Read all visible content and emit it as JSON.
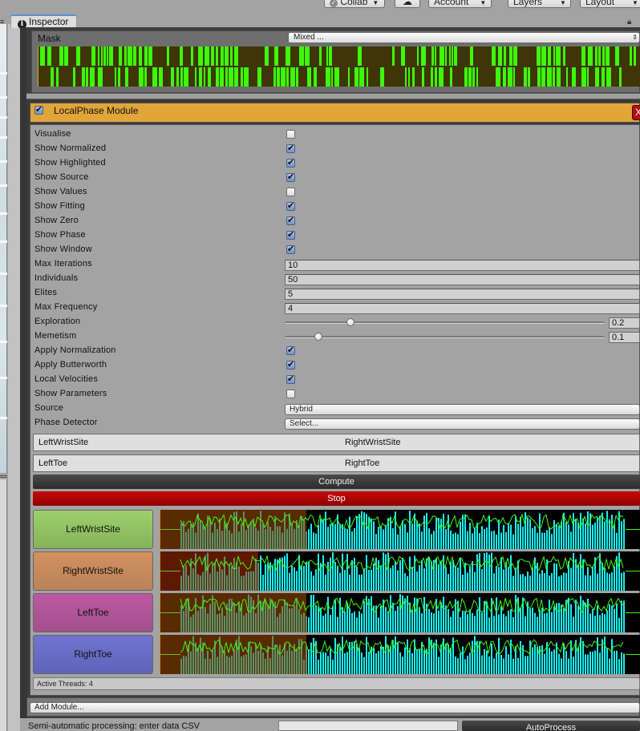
{
  "toolbar": {
    "collab_label": "Collab",
    "cloud_icon": "cloud-icon",
    "account_label": "Account",
    "layers_label": "Layers",
    "layout_label": "Layout"
  },
  "tab": {
    "menu_icon": "≡",
    "title": "Inspector",
    "icon": "info-icon",
    "info_glyph": "i",
    "lock_icon": "lock-icon"
  },
  "mask": {
    "label": "Mask",
    "dropdown_value": "Mixed ...",
    "bar_colors": {
      "on": "#3ef80a",
      "off": "#3f3506"
    }
  },
  "module": {
    "enabled": true,
    "title": "LocalPhase Module",
    "close_label": "X",
    "header_color": "#e0a63a",
    "toggles": [
      {
        "label": "Visualise",
        "checked": false
      },
      {
        "label": "Show Normalized",
        "checked": true
      },
      {
        "label": "Show Highlighted",
        "checked": true
      },
      {
        "label": "Show Source",
        "checked": true
      },
      {
        "label": "Show Values",
        "checked": false
      },
      {
        "label": "Show Fitting",
        "checked": true
      },
      {
        "label": "Show Zero",
        "checked": true
      },
      {
        "label": "Show Phase",
        "checked": true
      },
      {
        "label": "Show Window",
        "checked": true
      }
    ],
    "fields": [
      {
        "label": "Max Iterations",
        "value": "10"
      },
      {
        "label": "Individuals",
        "value": "50"
      },
      {
        "label": "Elites",
        "value": "5"
      },
      {
        "label": "Max Frequency",
        "value": "4"
      }
    ],
    "sliders": [
      {
        "label": "Exploration",
        "value": "0.2",
        "fraction": 0.2
      },
      {
        "label": "Memetism",
        "value": "0.1",
        "fraction": 0.1
      }
    ],
    "toggles2": [
      {
        "label": "Apply Normalization",
        "checked": true
      },
      {
        "label": "Apply Butterworth",
        "checked": true
      },
      {
        "label": "Local Velocities",
        "checked": true
      },
      {
        "label": "Show Parameters",
        "checked": false
      }
    ],
    "source": {
      "label": "Source",
      "value": "Hybrid"
    },
    "phase_detector": {
      "label": "Phase Detector",
      "value": "Select..."
    },
    "bone_pairs": [
      {
        "left": "LeftWristSite",
        "right": "RightWristSite"
      },
      {
        "left": "LeftToe",
        "right": "RightToe"
      }
    ],
    "compute_label": "Compute",
    "stop_label": "Stop",
    "bones": [
      {
        "label": "LeftWristSite",
        "color_top": "#9dd06c",
        "color_bottom": "#86b35a",
        "progress": 0.31
      },
      {
        "label": "RightWristSite",
        "color_top": "#d4905f",
        "color_bottom": "#b8835a",
        "progress": 0.21
      },
      {
        "label": "LeftToe",
        "color_top": "#bd57a3",
        "color_bottom": "#a3508d",
        "progress": 0.31
      },
      {
        "label": "RightToe",
        "color_top": "#6f74d0",
        "color_bottom": "#6064b8",
        "progress": 0.31
      }
    ],
    "active_threads": "Active Threads: 4"
  },
  "add_module_label": "Add Module...",
  "csv": {
    "label": "Semi-automatic processing: enter data CSV",
    "input_value": "",
    "autoprocess_label": "AutoProcess"
  }
}
